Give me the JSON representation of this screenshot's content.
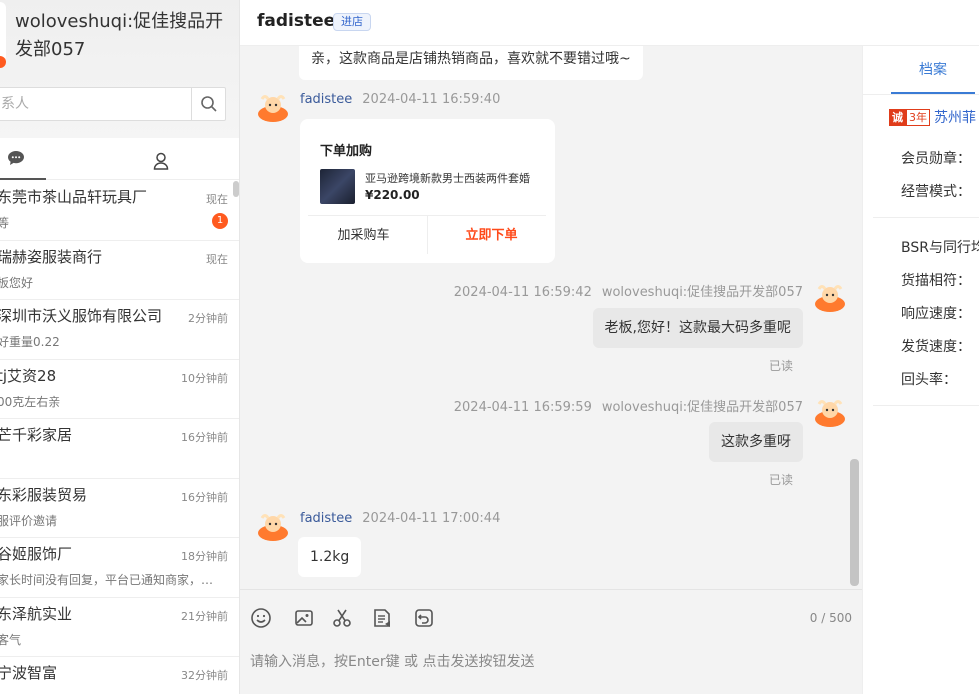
{
  "user": {
    "name": "woloveshuqi:促佳搜品开发部057"
  },
  "search": {
    "placeholder": "系人"
  },
  "conversations": [
    {
      "name": "东莞市茶山品轩玩具厂",
      "time": "现在",
      "last": "等",
      "badge": "1"
    },
    {
      "name": "瑞赫姿服装商行",
      "time": "现在",
      "last": "板您好",
      "badge": ""
    },
    {
      "name": "深圳市沃义服饰有限公司",
      "time": "2分钟前",
      "last": "好重量0.22",
      "badge": ""
    },
    {
      "name": "tj艾资28",
      "time": "10分钟前",
      "last": "00克左右亲",
      "badge": ""
    },
    {
      "name": "芒千彩家居",
      "time": "16分钟前",
      "last": "!",
      "badge": ""
    },
    {
      "name": "东彩服装贸易",
      "time": "16分钟前",
      "last": "服评价邀请",
      "badge": ""
    },
    {
      "name": "谷姬服饰厂",
      "time": "18分钟前",
      "last": "家长时间没有回复，平台已通知商家，…",
      "badge": ""
    },
    {
      "name": "东泽航实业",
      "time": "21分钟前",
      "last": "客气",
      "badge": ""
    },
    {
      "name": "宁波智富",
      "time": "32分钟前",
      "last": "",
      "badge": ""
    }
  ],
  "chat": {
    "shop_name": "fadistee",
    "enter_label": "进店",
    "messages": {
      "m0_text": "亲，这款商品是店铺热销商品，喜欢就不要错过哦~",
      "m1_name": "fadistee",
      "m1_time": "2024-04-11 16:59:40",
      "order_title": "下单加购",
      "order_desc": "亚马逊跨境新款男士西装两件套婚",
      "order_price": "¥220.00",
      "order_cart": "加采购车",
      "order_buy": "立即下单",
      "m2_time": "2024-04-11 16:59:42",
      "m2_name": "woloveshuqi:促佳搜品开发部057",
      "m2_text": "老板,您好！这款最大码多重呢",
      "m2_read": "已读",
      "m3_time": "2024-04-11 16:59:59",
      "m3_name": "woloveshuqi:促佳搜品开发部057",
      "m3_text": "这款多重呀",
      "m3_read": "已读",
      "m4_name": "fadistee",
      "m4_time": "2024-04-11 17:00:44",
      "m4_text": "1.2kg"
    },
    "char_count": "0 / 500",
    "input_placeholder": "请输入消息，按Enter键 或 点击发送按钮发送"
  },
  "profile": {
    "tab_label": "档案",
    "badge_main": "诚",
    "badge_years": "3年",
    "company": "苏州菲",
    "fields": [
      "会员勋章：",
      "经营模式：",
      "BSR与同行均",
      "货描相符：",
      "响应速度：",
      "发货速度：",
      "回头率："
    ]
  },
  "colors": {
    "accent": "#3a7bd5",
    "badge": "#ff5a1f",
    "buy": "#ff4a1a"
  },
  "icons": [
    "search-icon",
    "chat-icon",
    "contacts-icon",
    "emoji-icon",
    "image-icon",
    "scissors-icon",
    "document-icon",
    "history-icon",
    "double-chevron-right-icon"
  ]
}
